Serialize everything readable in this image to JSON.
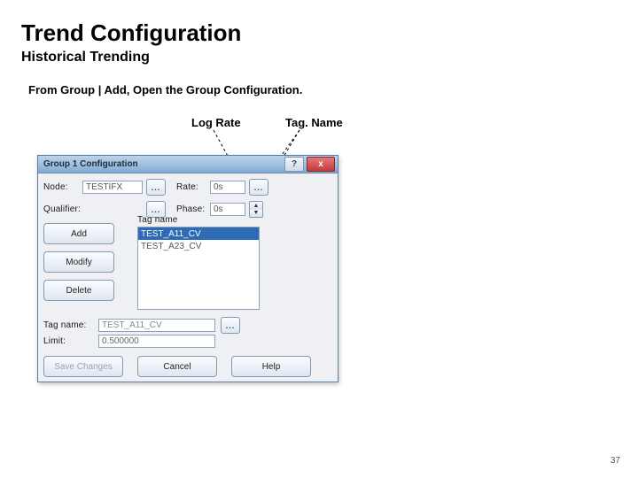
{
  "title": "Trend Configuration",
  "subtitle": "Historical Trending",
  "instruction": "From Group | Add, Open the Group Configuration.",
  "callouts": {
    "log_rate": "Log Rate",
    "tag_name": "Tag. Name"
  },
  "page_number": "37",
  "dialog": {
    "title": "Group 1 Configuration",
    "help_tip": "?",
    "close_tip": "x",
    "labels": {
      "node": "Node:",
      "rate": "Rate:",
      "qualifier": "Qualifier:",
      "phase": "Phase:",
      "tagname_list": "Tag name",
      "tagname_field": "Tag name:",
      "limit": "Limit:"
    },
    "values": {
      "node": "TESTIFX",
      "rate": "0s",
      "phase": "0s",
      "tagname_field": "TEST_A11_CV",
      "limit": "0.500000"
    },
    "list": [
      "TEST_A11_CV",
      "TEST_A23_CV"
    ],
    "buttons": {
      "add": "Add",
      "modify": "Modify",
      "delete": "Delete",
      "save": "Save Changes",
      "cancel": "Cancel",
      "help": "Help",
      "browse": "..."
    }
  }
}
